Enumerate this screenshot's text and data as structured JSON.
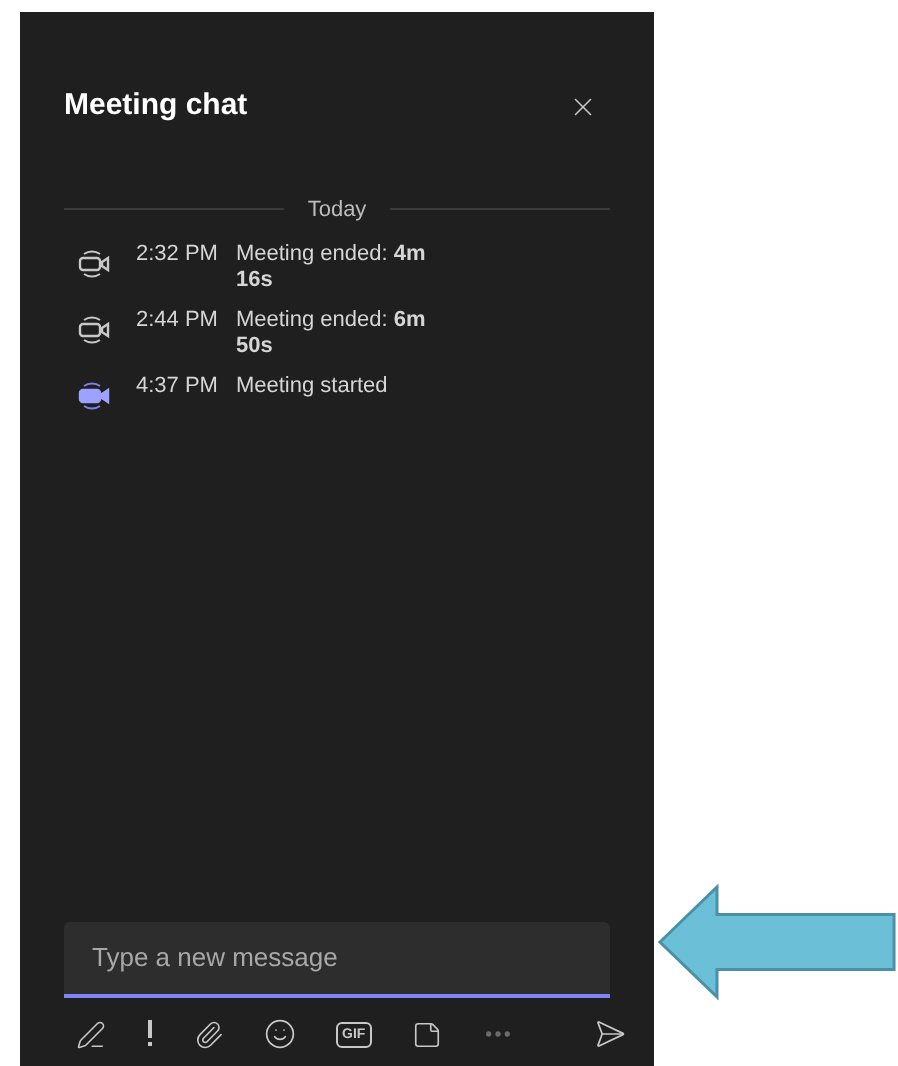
{
  "panel": {
    "title": "Meeting chat"
  },
  "divider": {
    "label": "Today"
  },
  "events": [
    {
      "kind": "ended",
      "time": "2:32 PM",
      "text": "Meeting ended: **4m 16s**"
    },
    {
      "kind": "ended",
      "time": "2:44 PM",
      "text": "Meeting ended: **6m 50s**"
    },
    {
      "kind": "started",
      "time": "4:37 PM",
      "text": "Meeting started"
    }
  ],
  "composer": {
    "placeholder": "Type a new message",
    "gif_label": "GIF"
  }
}
